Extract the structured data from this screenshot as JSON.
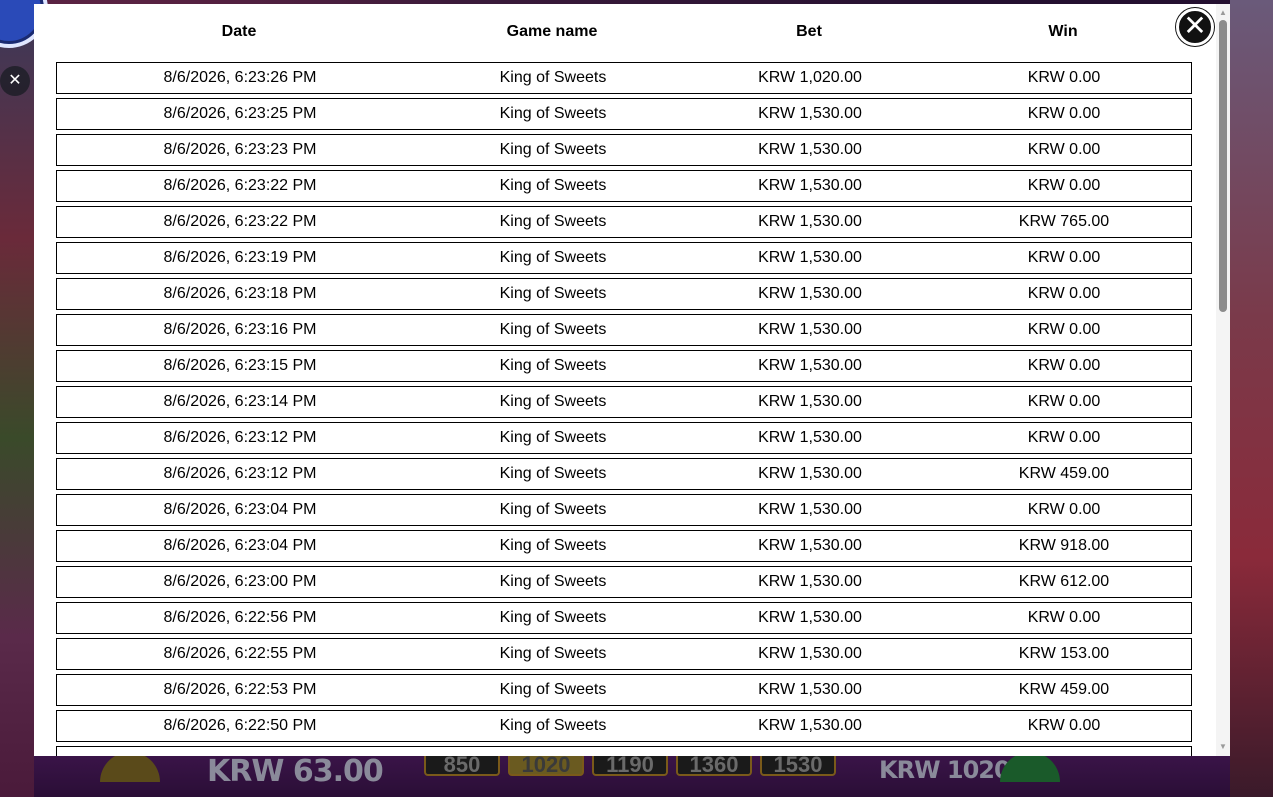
{
  "background": {
    "balance": "KRW 63.00",
    "chips": [
      "850",
      "1020",
      "1190",
      "1360",
      "1530"
    ],
    "active_chip": "1020",
    "total_bet": "KRW 1020.00",
    "close_icon": "close-icon"
  },
  "history": {
    "columns": {
      "date": "Date",
      "game": "Game name",
      "bet": "Bet",
      "win": "Win"
    },
    "rows": [
      {
        "date": "8/6/2026, 6:23:26 PM",
        "game": "King of Sweets",
        "bet": "KRW 1,020.00",
        "win": "KRW 0.00"
      },
      {
        "date": "8/6/2026, 6:23:25 PM",
        "game": "King of Sweets",
        "bet": "KRW 1,530.00",
        "win": "KRW 0.00"
      },
      {
        "date": "8/6/2026, 6:23:23 PM",
        "game": "King of Sweets",
        "bet": "KRW 1,530.00",
        "win": "KRW 0.00"
      },
      {
        "date": "8/6/2026, 6:23:22 PM",
        "game": "King of Sweets",
        "bet": "KRW 1,530.00",
        "win": "KRW 0.00"
      },
      {
        "date": "8/6/2026, 6:23:22 PM",
        "game": "King of Sweets",
        "bet": "KRW 1,530.00",
        "win": "KRW 765.00"
      },
      {
        "date": "8/6/2026, 6:23:19 PM",
        "game": "King of Sweets",
        "bet": "KRW 1,530.00",
        "win": "KRW 0.00"
      },
      {
        "date": "8/6/2026, 6:23:18 PM",
        "game": "King of Sweets",
        "bet": "KRW 1,530.00",
        "win": "KRW 0.00"
      },
      {
        "date": "8/6/2026, 6:23:16 PM",
        "game": "King of Sweets",
        "bet": "KRW 1,530.00",
        "win": "KRW 0.00"
      },
      {
        "date": "8/6/2026, 6:23:15 PM",
        "game": "King of Sweets",
        "bet": "KRW 1,530.00",
        "win": "KRW 0.00"
      },
      {
        "date": "8/6/2026, 6:23:14 PM",
        "game": "King of Sweets",
        "bet": "KRW 1,530.00",
        "win": "KRW 0.00"
      },
      {
        "date": "8/6/2026, 6:23:12 PM",
        "game": "King of Sweets",
        "bet": "KRW 1,530.00",
        "win": "KRW 0.00"
      },
      {
        "date": "8/6/2026, 6:23:12 PM",
        "game": "King of Sweets",
        "bet": "KRW 1,530.00",
        "win": "KRW 459.00"
      },
      {
        "date": "8/6/2026, 6:23:04 PM",
        "game": "King of Sweets",
        "bet": "KRW 1,530.00",
        "win": "KRW 0.00"
      },
      {
        "date": "8/6/2026, 6:23:04 PM",
        "game": "King of Sweets",
        "bet": "KRW 1,530.00",
        "win": "KRW 918.00"
      },
      {
        "date": "8/6/2026, 6:23:00 PM",
        "game": "King of Sweets",
        "bet": "KRW 1,530.00",
        "win": "KRW 612.00"
      },
      {
        "date": "8/6/2026, 6:22:56 PM",
        "game": "King of Sweets",
        "bet": "KRW 1,530.00",
        "win": "KRW 0.00"
      },
      {
        "date": "8/6/2026, 6:22:55 PM",
        "game": "King of Sweets",
        "bet": "KRW 1,530.00",
        "win": "KRW 153.00"
      },
      {
        "date": "8/6/2026, 6:22:53 PM",
        "game": "King of Sweets",
        "bet": "KRW 1,530.00",
        "win": "KRW 459.00"
      },
      {
        "date": "8/6/2026, 6:22:50 PM",
        "game": "King of Sweets",
        "bet": "KRW 1,530.00",
        "win": "KRW 0.00"
      }
    ],
    "close_icon": "close-icon"
  }
}
